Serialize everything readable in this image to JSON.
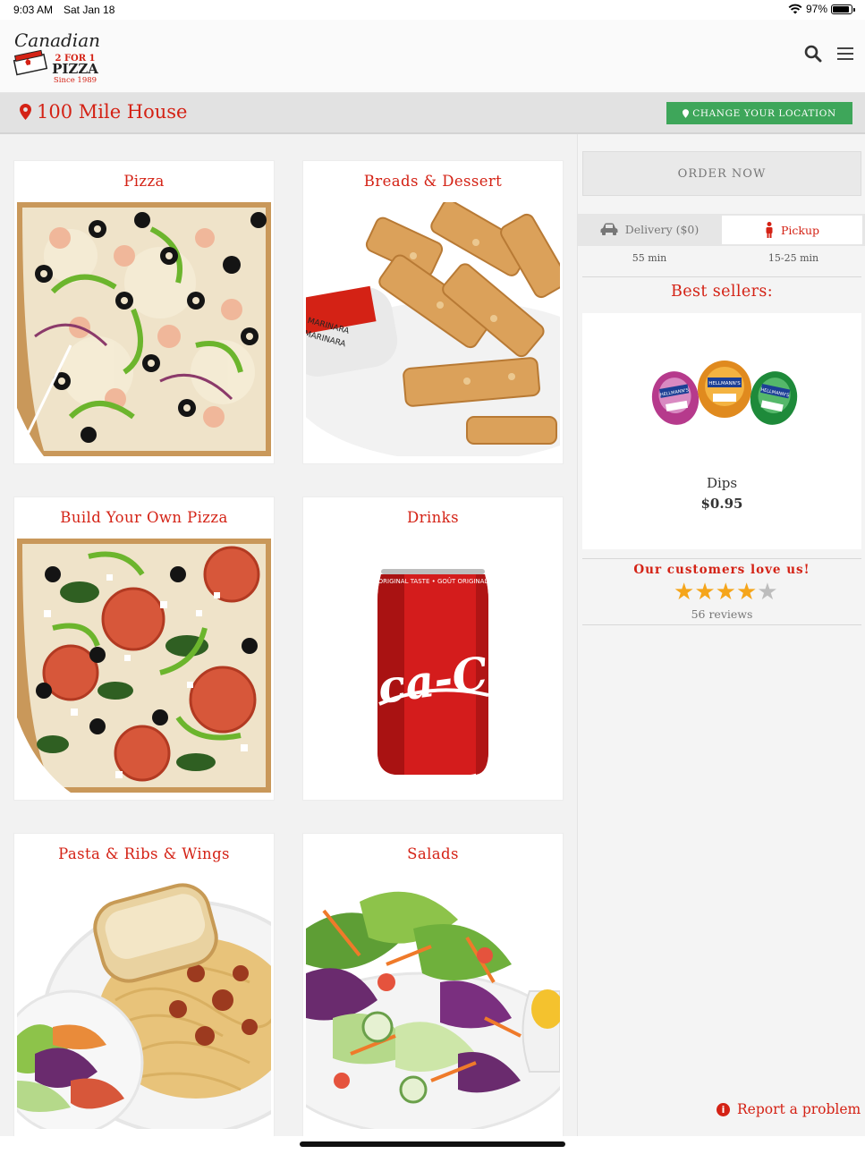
{
  "status_bar": {
    "time": "9:03 AM",
    "date": "Sat Jan 18",
    "battery": "97%",
    "battery_level": 0.97
  },
  "header": {
    "logo": {
      "line1": "Canadian",
      "line2": "2 FOR 1",
      "line3": "PIZZA",
      "line4": "Since 1989"
    },
    "icons": [
      "search-icon",
      "menu-icon"
    ]
  },
  "location": {
    "name": "100 Mile House",
    "change_label": "CHANGE YOUR LOCATION"
  },
  "categories": [
    {
      "title": "Pizza"
    },
    {
      "title": "Breads & Dessert"
    },
    {
      "title": "Build Your Own Pizza"
    },
    {
      "title": "Drinks"
    },
    {
      "title": "Pasta & Ribs & Wings"
    },
    {
      "title": "Salads"
    }
  ],
  "sidebar": {
    "order_now": "ORDER NOW",
    "delivery": {
      "label": "Delivery ($0)",
      "time": "55 min"
    },
    "pickup": {
      "label": "Pickup",
      "time": "15-25 min"
    },
    "best_sellers_title": "Best sellers:",
    "product": {
      "name": "Dips",
      "price": "$0.95",
      "labels": [
        "HELLMANN'S",
        "HELLMANN'S",
        "HELLMANN'S"
      ]
    },
    "love_title": "Our customers love us!",
    "rating": 4,
    "rating_max": 5,
    "reviews": "56 reviews",
    "report": "Report a problem"
  },
  "drink_can": {
    "text": "Coca-Cola",
    "small": "ORIGINAL TASTE • GOÛT ORIGINAL"
  },
  "dip_cup": {
    "text1": "MARINARA",
    "text2": "MARINARA"
  },
  "colors": {
    "accent": "#d42215",
    "green": "#3ea65a",
    "star": "#f5a51b"
  }
}
